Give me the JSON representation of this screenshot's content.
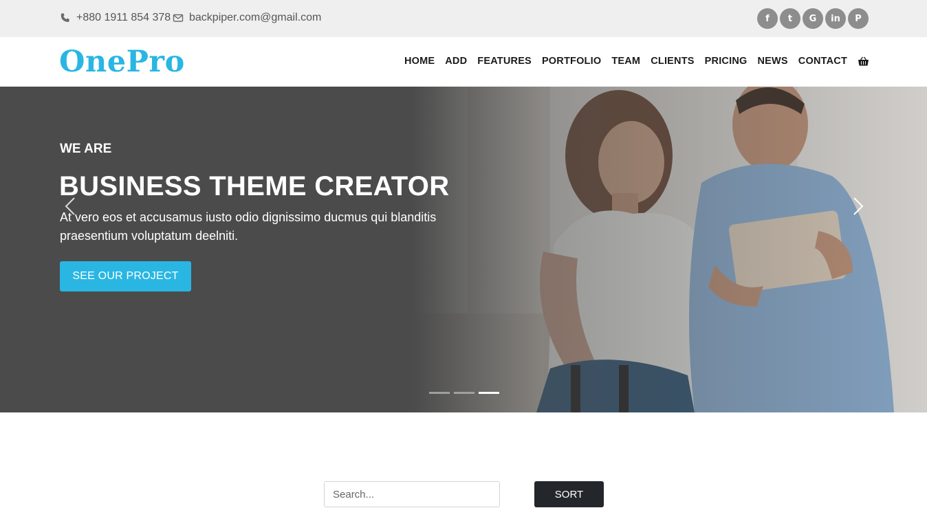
{
  "topbar": {
    "phone": "+880 1911 854 378",
    "email": "backpiper.com@gmail.com",
    "social": [
      {
        "icon": "facebook-icon",
        "glyph": "f"
      },
      {
        "icon": "twitter-icon",
        "glyph": "t"
      },
      {
        "icon": "google-icon",
        "glyph": "G"
      },
      {
        "icon": "linkedin-icon",
        "glyph": "in"
      },
      {
        "icon": "pinterest-icon",
        "glyph": "P"
      }
    ]
  },
  "navbar": {
    "logo": "OnePro",
    "items": [
      "HOME",
      "ADD",
      "FEATURES",
      "PORTFOLIO",
      "TEAM",
      "CLIENTS",
      "PRICING",
      "NEWS",
      "CONTACT"
    ],
    "cart_icon": "basket-icon"
  },
  "hero": {
    "eyebrow": "WE ARE",
    "title": "BUSINESS THEME CREATOR",
    "description": "At vero eos et accusamus iusto odio dignissimo ducmus qui blanditis praesentium voluptatum deelniti.",
    "cta": "SEE OUR PROJECT",
    "slides": 3,
    "active_slide": 3
  },
  "toolbar": {
    "search_placeholder": "Search...",
    "sort_label": "SORT"
  },
  "colors": {
    "accent": "#29b6e3",
    "topbar_bg": "#efefef",
    "hero_overlay": "#4b4b4b",
    "dark_button": "#23272b"
  }
}
